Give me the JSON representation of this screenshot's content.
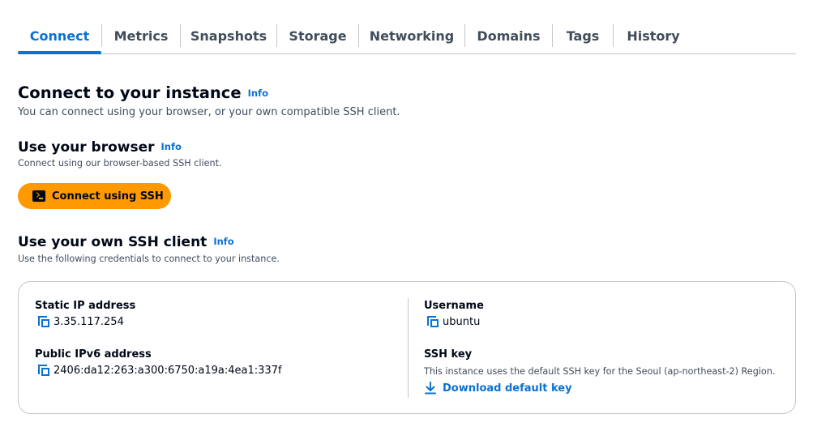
{
  "tabs": [
    {
      "label": "Connect",
      "active": true
    },
    {
      "label": "Metrics",
      "active": false
    },
    {
      "label": "Snapshots",
      "active": false
    },
    {
      "label": "Storage",
      "active": false
    },
    {
      "label": "Networking",
      "active": false
    },
    {
      "label": "Domains",
      "active": false
    },
    {
      "label": "Tags",
      "active": false
    },
    {
      "label": "History",
      "active": false
    }
  ],
  "connect": {
    "title": "Connect to your instance",
    "info": "Info",
    "description": "You can connect using your browser, or your own compatible SSH client."
  },
  "browser": {
    "title": "Use your browser",
    "info": "Info",
    "description": "Connect using our browser-based SSH client.",
    "button_label": "Connect using SSH",
    "button_icon": "terminal-icon"
  },
  "ssh_client": {
    "title": "Use your own SSH client",
    "info": "Info",
    "description": "Use the following credentials to connect to your instance."
  },
  "credentials": {
    "static_ip_label": "Static IP address",
    "static_ip_value": "3.35.117.254",
    "ipv6_label": "Public IPv6 address",
    "ipv6_value": "2406:da12:263:a300:6750:a19a:4ea1:337f",
    "username_label": "Username",
    "username_value": "ubuntu",
    "ssh_key_label": "SSH key",
    "ssh_key_note": "This instance uses the default SSH key for the Seoul (ap-northeast-2) Region.",
    "download_label": "Download default key",
    "copy_icon": "copy-icon",
    "download_icon": "download-icon"
  },
  "colors": {
    "accent": "#0972d3",
    "button": "#ff9900",
    "text": "#000716",
    "muted": "#414d5c",
    "border": "#c6c6cd"
  }
}
